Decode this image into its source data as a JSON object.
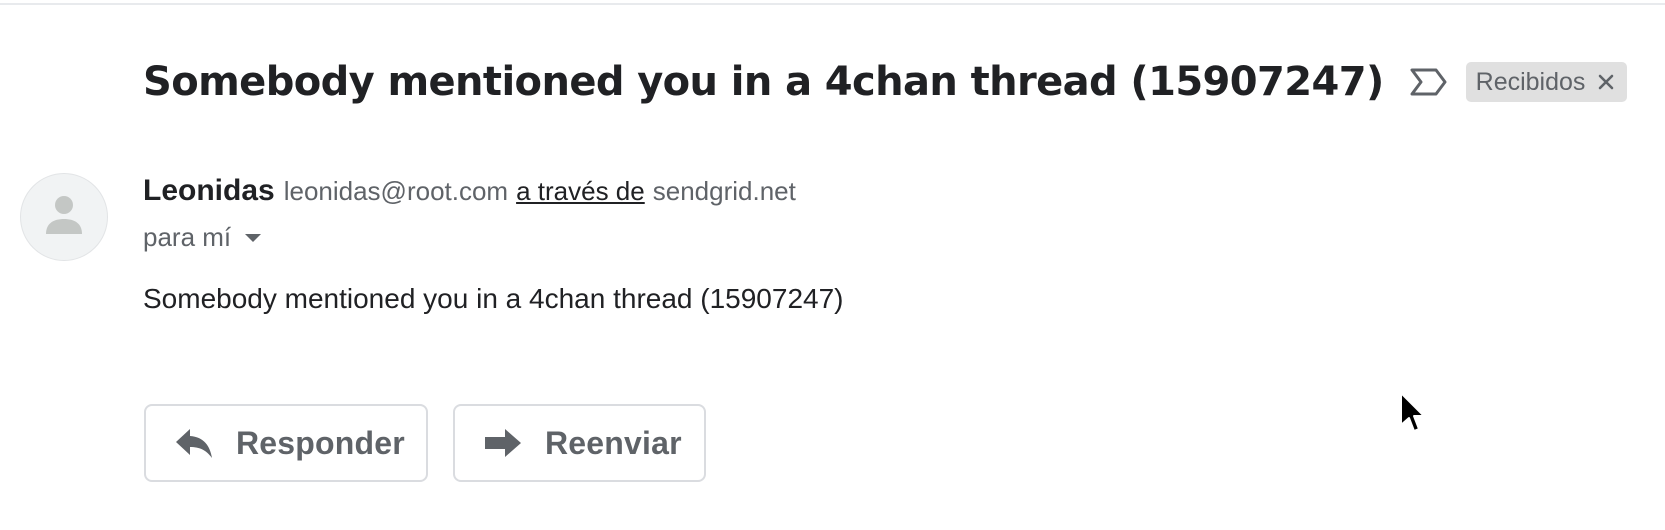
{
  "subject": {
    "text": "Somebody mentioned you in a 4chan thread (15907247)",
    "important_icon": "label-important-outline-icon",
    "label": {
      "text": "Recibidos",
      "close_icon": "close-icon"
    }
  },
  "sender": {
    "avatar_icon": "person-icon",
    "name": "Leonidas",
    "email": "leonidas@root.com",
    "via_text": "a través de",
    "via_domain": "sendgrid.net"
  },
  "recipient": {
    "text": "para mí",
    "dropdown_icon": "arrow-drop-down-icon"
  },
  "message": {
    "body": "Somebody mentioned you in a 4chan thread (15907247)"
  },
  "actions": {
    "reply": {
      "label": "Responder",
      "icon": "reply-icon"
    },
    "forward": {
      "label": "Reenviar",
      "icon": "forward-icon"
    }
  },
  "colors": {
    "text": "#202124",
    "secondary": "#5f6368",
    "chip_bg": "#e0e0e0",
    "border": "#dadce0",
    "avatar_bg": "#f1f3f4"
  }
}
